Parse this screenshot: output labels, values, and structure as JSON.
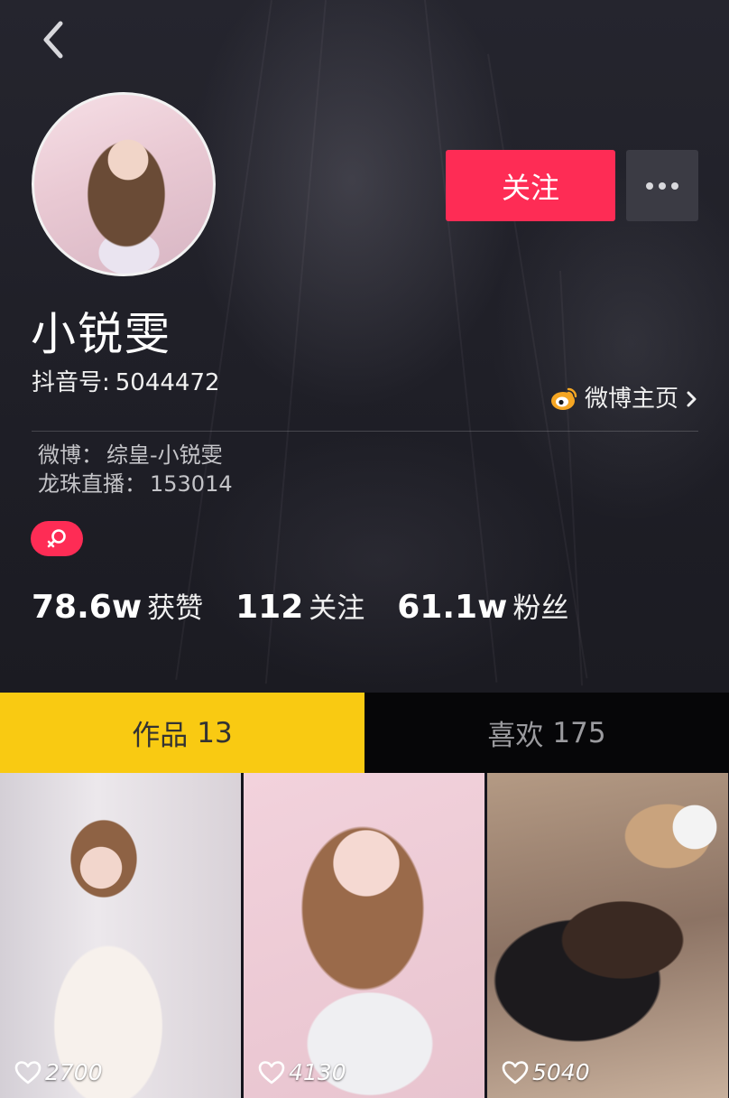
{
  "profile": {
    "username": "小锐雯",
    "douyin_id_label": "抖音号:",
    "douyin_id_value": "5044472",
    "weibo_link_label": "微博主页",
    "bio_line1_label": "微博：",
    "bio_line1_value": "综皇-小锐雯",
    "bio_line2_label": "龙珠直播：",
    "bio_line2_value": "153014",
    "gender": "female-icon"
  },
  "actions": {
    "follow_label": "关注",
    "more_icon": "more-dots-icon"
  },
  "stats": {
    "likes_value": "78.6w",
    "likes_label": "获赞",
    "following_value": "112",
    "following_label": "关注",
    "followers_value": "61.1w",
    "followers_label": "粉丝"
  },
  "tabs": [
    {
      "label": "作品",
      "count": "13",
      "active": true
    },
    {
      "label": "喜欢",
      "count": "175",
      "active": false
    }
  ],
  "videos": [
    {
      "likes": "2700"
    },
    {
      "likes": "4130"
    },
    {
      "likes": "5040"
    }
  ],
  "colors": {
    "accent_red": "#fe2c55",
    "tab_active_yellow": "#f9ca12",
    "background": "#1f1f27",
    "weibo_orange": "#f5a623"
  }
}
